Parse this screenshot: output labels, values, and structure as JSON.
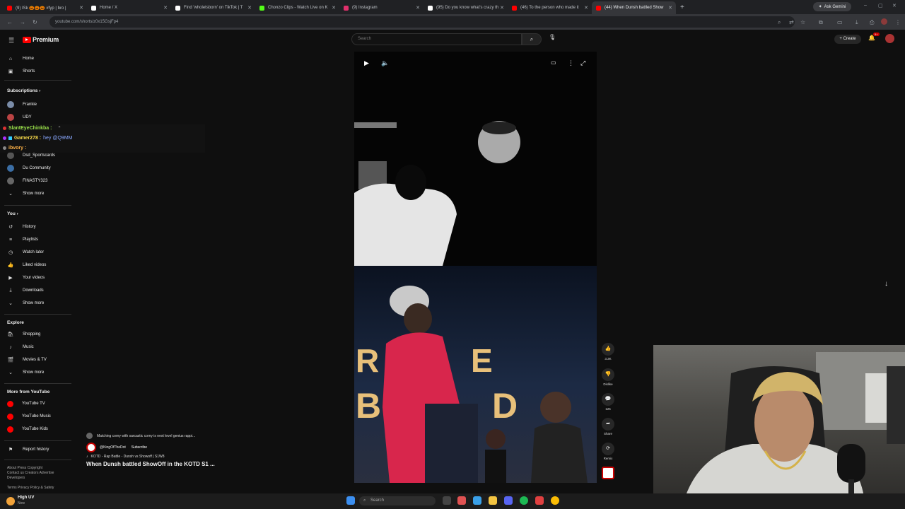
{
  "browser": {
    "tabs": [
      {
        "label": "(9) ISk 🎃🎃🎃 #fyp | bro |",
        "color": "#ff0000"
      },
      {
        "label": "Home / X",
        "color": "#ffffff"
      },
      {
        "label": "Find 'wholetsborn' on TikTok | T",
        "color": "#ffffff"
      },
      {
        "label": "Chonzo Clips - Watch Live on K",
        "color": "#53fc18"
      },
      {
        "label": "(9) Instagram",
        "color": "#e1306c"
      },
      {
        "label": "(95) Do you know what's crazy th",
        "color": "#ffffff"
      },
      {
        "label": "(46) To the person who made it",
        "color": "#ff0000"
      },
      {
        "label": "(44) When Dunsh battled Show",
        "color": "#ff0000"
      }
    ],
    "ask_gemini": "Ask Gemini",
    "url": "youtube.com/shorts/z0x15GsjFp4"
  },
  "youtube": {
    "logo_text": "Premium",
    "search_placeholder": "Search",
    "create_label": "Create",
    "notif_count": "9+"
  },
  "sidebar": {
    "top": [
      {
        "label": "Home",
        "icon": "home-icon",
        "glyph": "⌂"
      },
      {
        "label": "Shorts",
        "icon": "shorts-icon",
        "glyph": "▣"
      }
    ],
    "subscriptions_header": "Subscriptions",
    "subscriptions": [
      {
        "label": "Frankie",
        "color": "#7a8ca8"
      },
      {
        "label": "UDY",
        "color": "#b44"
      },
      {
        "label": "Dsd_Sportscards",
        "color": "#555"
      },
      {
        "label": "Du Community",
        "color": "#3b6ea5"
      },
      {
        "label": "FINASTY323",
        "color": "#666"
      }
    ],
    "show_more": "Show more",
    "you_header": "You",
    "you": [
      {
        "label": "History",
        "icon": "history-icon",
        "glyph": "↺"
      },
      {
        "label": "Playlists",
        "icon": "playlists-icon",
        "glyph": "≡"
      },
      {
        "label": "Watch later",
        "icon": "watch-later-icon",
        "glyph": "◷"
      },
      {
        "label": "Liked videos",
        "icon": "like-icon",
        "glyph": "👍"
      },
      {
        "label": "Your videos",
        "icon": "your-videos-icon",
        "glyph": "▶"
      },
      {
        "label": "Downloads",
        "icon": "download-icon",
        "glyph": "⤓"
      }
    ],
    "explore_header": "Explore",
    "explore": [
      {
        "label": "Shopping",
        "icon": "shopping-icon",
        "glyph": "🛍"
      },
      {
        "label": "Music",
        "icon": "music-icon",
        "glyph": "♪"
      },
      {
        "label": "Movies & TV",
        "icon": "movies-icon",
        "glyph": "🎬"
      }
    ],
    "more_header": "More from YouTube",
    "more": [
      {
        "label": "YouTube TV",
        "color": "#ff0000"
      },
      {
        "label": "YouTube Music",
        "color": "#ff0000"
      },
      {
        "label": "YouTube Kids",
        "color": "#ff0000"
      }
    ],
    "report": "Report history",
    "footer1": "About  Press  Copyright",
    "footer2": "Contact us  Creators  Advertise",
    "footer3": "Developers",
    "footer4": "Terms  Privacy  Policy & Safety"
  },
  "chat": [
    {
      "user": "SlantEyeChinkba :",
      "text": "",
      "color": "#9be24a"
    },
    {
      "user": "Gamer278 :",
      "text": "hey @Q9MM",
      "color": "#f6d84a",
      "textcolor": "#8aa8ff"
    },
    {
      "user": "ibvory :",
      "text": "",
      "color": "#ffb347"
    }
  ],
  "short": {
    "comment_preview": "Matching corny with sarcastic corny is next level genius rappi...",
    "channel": "@KingOfTheDot",
    "subscribe": "Subscribe",
    "music": "KOTD - Rap Battle - Dunsh vs Showoff | S1W8",
    "title": "When Dunsh battled ShowOff in the KOTD S1 ...",
    "likes": "3.3K",
    "dislike": "Dislike",
    "comments": "125",
    "share": "Share",
    "remix": "Remix"
  },
  "taskbar": {
    "weather_temp": "High UV",
    "weather_sub": "Now",
    "search": "Search"
  }
}
